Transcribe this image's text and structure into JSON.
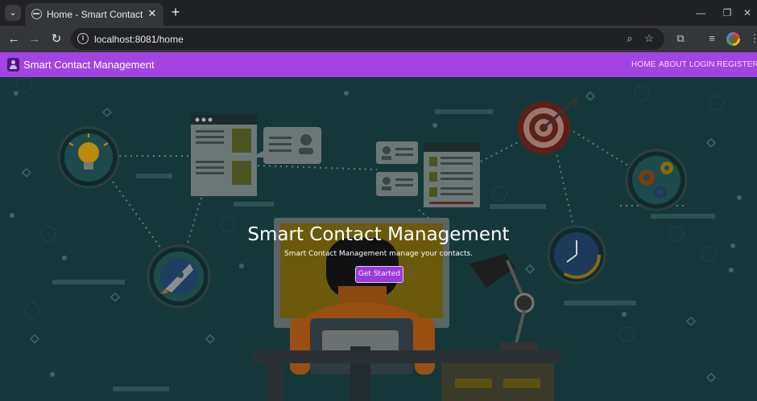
{
  "browser": {
    "tab_title": "Home - Smart Contact Manager",
    "url": "localhost:8081/home",
    "icons": [
      "tab-search-icon",
      "globe-icon",
      "close-icon",
      "plus-icon",
      "minimize-icon",
      "restore-icon",
      "close-window-icon",
      "back-icon",
      "forward-icon",
      "reload-icon",
      "site-info-icon",
      "zoom-icon",
      "star-icon",
      "extensions-icon",
      "media-icon",
      "profile-avatar",
      "more-icon"
    ]
  },
  "navbar": {
    "brand": "Smart Contact Management",
    "links": [
      "HOME",
      "ABOUT",
      "LOGIN",
      "REGISTER"
    ],
    "color": "#a243e2"
  },
  "hero": {
    "title": "Smart Contact Management",
    "subtitle": "Smart Contact Management manage your contacts.",
    "button": "Get Started",
    "background": "#14383a",
    "accent": "#9b3ad8"
  }
}
